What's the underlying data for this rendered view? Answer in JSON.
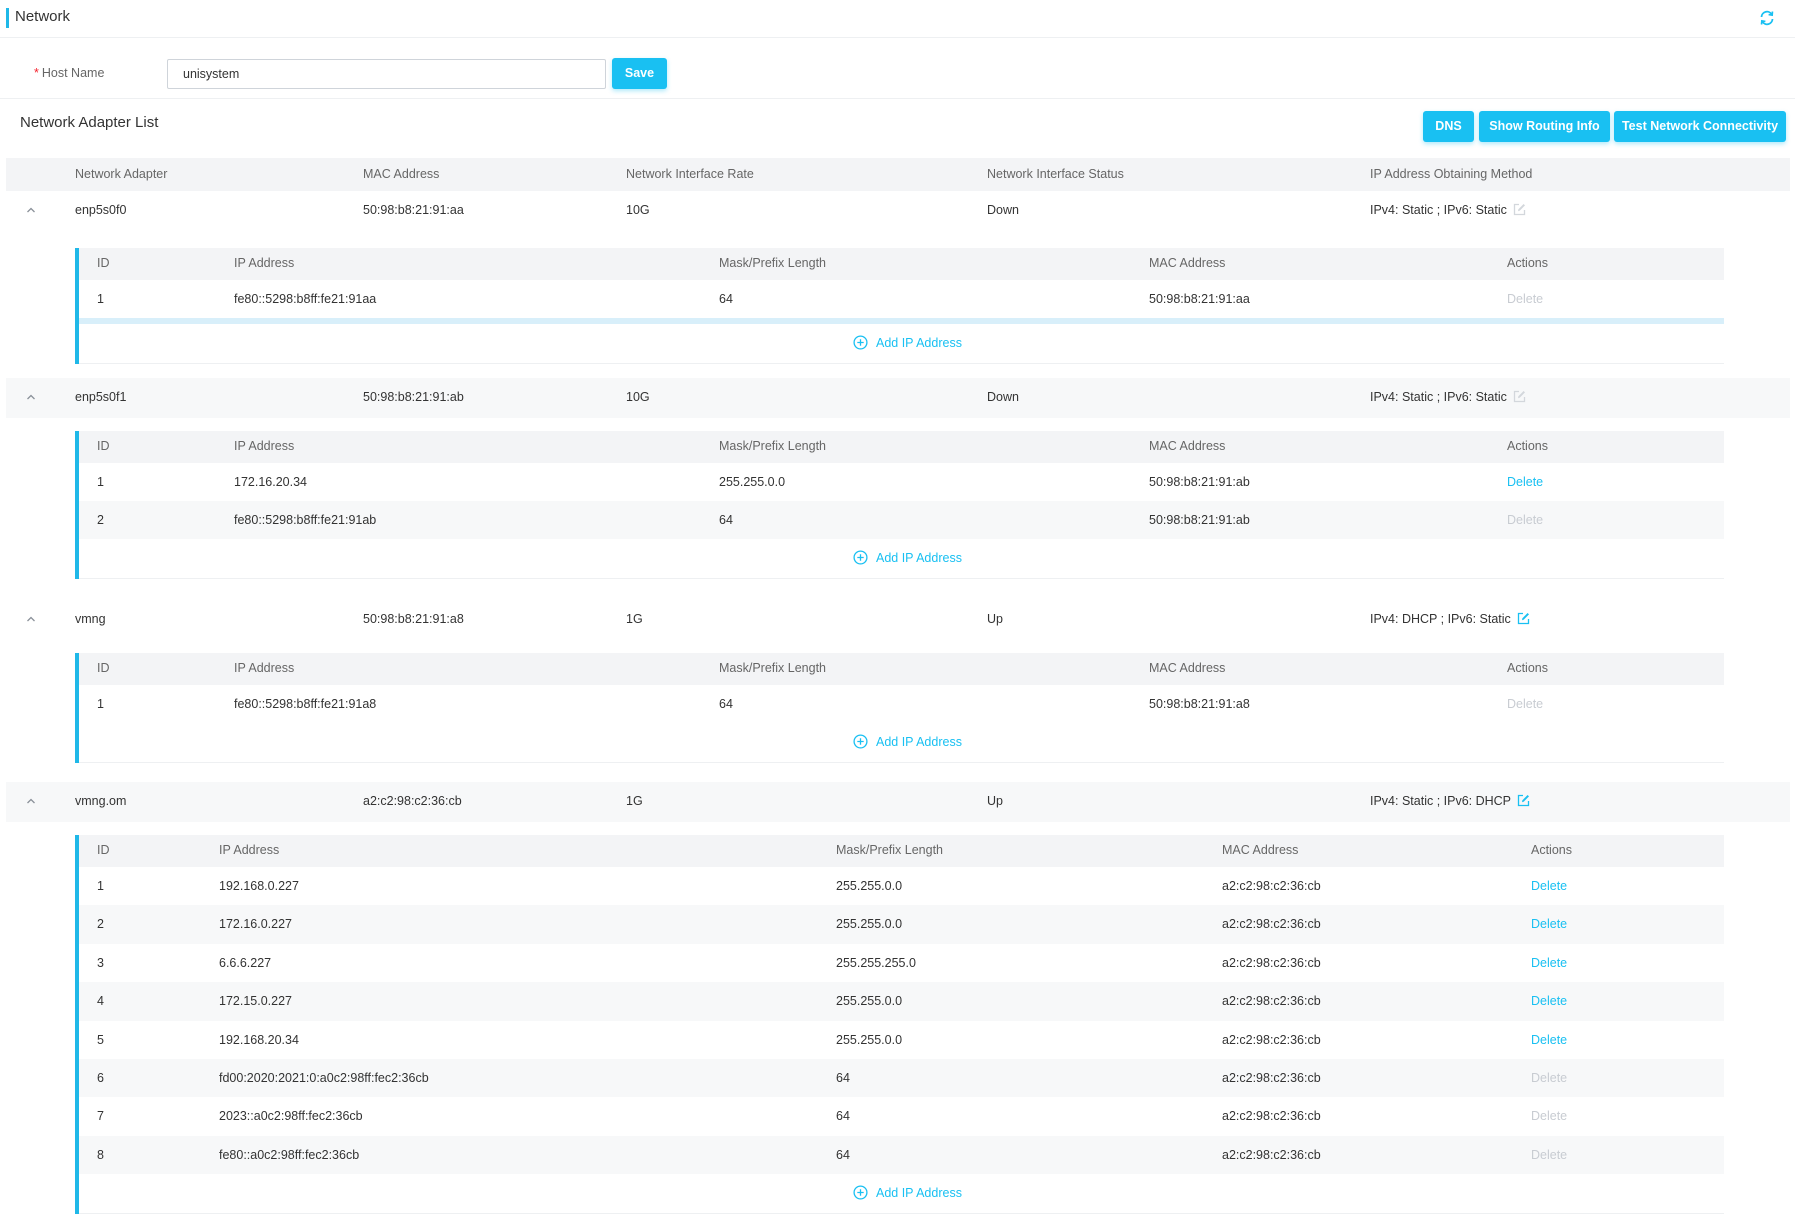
{
  "header": {
    "title": "Network",
    "refresh_icon": "refresh-icon"
  },
  "host": {
    "label": "Host Name",
    "required_mark": "*",
    "value": "unisystem",
    "save_label": "Save"
  },
  "list": {
    "title": "Network Adapter List",
    "buttons": {
      "dns": "DNS",
      "routing": "Show Routing Info",
      "test": "Test Network Connectivity"
    },
    "columns": [
      "Network Adapter",
      "MAC Address",
      "Network Interface Rate",
      "Network Interface Status",
      "IP Address Obtaining Method"
    ],
    "sub_columns": [
      "ID",
      "IP Address",
      "Mask/Prefix Length",
      "MAC Address",
      "Actions"
    ],
    "add_label": "Add IP Address"
  },
  "adapters": [
    {
      "name": "enp5s0f0",
      "mac": "50:98:b8:21:91:aa",
      "rate": "10G",
      "status": "Down",
      "method": "IPv4: Static ; IPv6: Static",
      "edit_enabled": false,
      "ips": [
        {
          "id": "1",
          "ip": "fe80::5298:b8ff:fe21:91aa",
          "mask": "64",
          "mac": "50:98:b8:21:91:aa",
          "action": "Delete",
          "action_enabled": false
        }
      ]
    },
    {
      "name": "enp5s0f1",
      "mac": "50:98:b8:21:91:ab",
      "rate": "10G",
      "status": "Down",
      "method": "IPv4: Static ; IPv6: Static",
      "edit_enabled": false,
      "ips": [
        {
          "id": "1",
          "ip": "172.16.20.34",
          "mask": "255.255.0.0",
          "mac": "50:98:b8:21:91:ab",
          "action": "Delete",
          "action_enabled": true
        },
        {
          "id": "2",
          "ip": "fe80::5298:b8ff:fe21:91ab",
          "mask": "64",
          "mac": "50:98:b8:21:91:ab",
          "action": "Delete",
          "action_enabled": false
        }
      ]
    },
    {
      "name": "vmng",
      "mac": "50:98:b8:21:91:a8",
      "rate": "1G",
      "status": "Up",
      "method": "IPv4: DHCP ; IPv6: Static",
      "edit_enabled": true,
      "ips": [
        {
          "id": "1",
          "ip": "fe80::5298:b8ff:fe21:91a8",
          "mask": "64",
          "mac": "50:98:b8:21:91:a8",
          "action": "Delete",
          "action_enabled": false
        }
      ]
    },
    {
      "name": "vmng.om",
      "mac": "a2:c2:98:c2:36:cb",
      "rate": "1G",
      "status": "Up",
      "method": "IPv4: Static ; IPv6: DHCP",
      "edit_enabled": true,
      "ips": [
        {
          "id": "1",
          "ip": "192.168.0.227",
          "mask": "255.255.0.0",
          "mac": "a2:c2:98:c2:36:cb",
          "action": "Delete",
          "action_enabled": true
        },
        {
          "id": "2",
          "ip": "172.16.0.227",
          "mask": "255.255.0.0",
          "mac": "a2:c2:98:c2:36:cb",
          "action": "Delete",
          "action_enabled": true
        },
        {
          "id": "3",
          "ip": "6.6.6.227",
          "mask": "255.255.255.0",
          "mac": "a2:c2:98:c2:36:cb",
          "action": "Delete",
          "action_enabled": true
        },
        {
          "id": "4",
          "ip": "172.15.0.227",
          "mask": "255.255.0.0",
          "mac": "a2:c2:98:c2:36:cb",
          "action": "Delete",
          "action_enabled": true
        },
        {
          "id": "5",
          "ip": "192.168.20.34",
          "mask": "255.255.0.0",
          "mac": "a2:c2:98:c2:36:cb",
          "action": "Delete",
          "action_enabled": true
        },
        {
          "id": "6",
          "ip": "fd00:2020:2021:0:a0c2:98ff:fec2:36cb",
          "mask": "64",
          "mac": "a2:c2:98:c2:36:cb",
          "action": "Delete",
          "action_enabled": false
        },
        {
          "id": "7",
          "ip": "2023::a0c2:98ff:fec2:36cb",
          "mask": "64",
          "mac": "a2:c2:98:c2:36:cb",
          "action": "Delete",
          "action_enabled": false
        },
        {
          "id": "8",
          "ip": "fe80::a0c2:98ff:fec2:36cb",
          "mask": "64",
          "mac": "a2:c2:98:c2:36:cb",
          "action": "Delete",
          "action_enabled": false
        }
      ]
    }
  ],
  "colors": {
    "accent": "#19c0f2",
    "bar": "#1fb8e8",
    "disabled": "#c8ccd2"
  }
}
